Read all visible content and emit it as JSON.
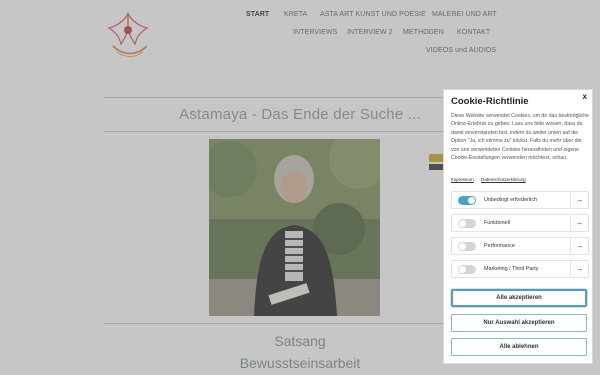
{
  "nav": {
    "row1": [
      "START",
      "KRETA",
      "ASTA ART KUNST UND POESIE",
      "MALEREI UND ART"
    ],
    "row2": [
      "INTERVIEWS",
      "INTERVIEW 2",
      "METHODEN",
      "KONTAKT"
    ],
    "row3": [
      "VIDEOS und AUDIOS"
    ]
  },
  "main": {
    "title": "Astamaya - Das Ende der Suche ...",
    "subtitle1": "Satsang",
    "subtitle2": "Bewusstseinsarbeit"
  },
  "cookie": {
    "close": "x",
    "title": "Cookie-Richtlinie",
    "text": "Diese Website verwendet Cookies, um dir das bestmögliche Online-Erlebnis zu geben. Lass uns bitte wissen, dass du damit einverstanden bist, indem du weiter unten auf die Option \"Ja, ich stimme zu\" klickst. Falls du mehr über die von uns verwendeten Cookies herausfinden und eigene Cookie-Einstellungen verwenden möchtest, schau",
    "link_impressum": "Impressum",
    "link_datenschutz": "Datenschutzerklärung",
    "categories": [
      {
        "label": "Unbedingt erforderlich",
        "on": true
      },
      {
        "label": "Funktionell",
        "on": false
      },
      {
        "label": "Performance",
        "on": false
      },
      {
        "label": "Marketing / Third Party",
        "on": false
      }
    ],
    "btn_accept_all": "Alle akzeptieren",
    "btn_accept_selection": "Nur Auswahl akzeptieren",
    "btn_reject_all": "Alle ablehnen"
  },
  "colors": {
    "accent": "#4aa3c7",
    "title": "#8a9aa6",
    "subtitle": "#7d9280"
  }
}
